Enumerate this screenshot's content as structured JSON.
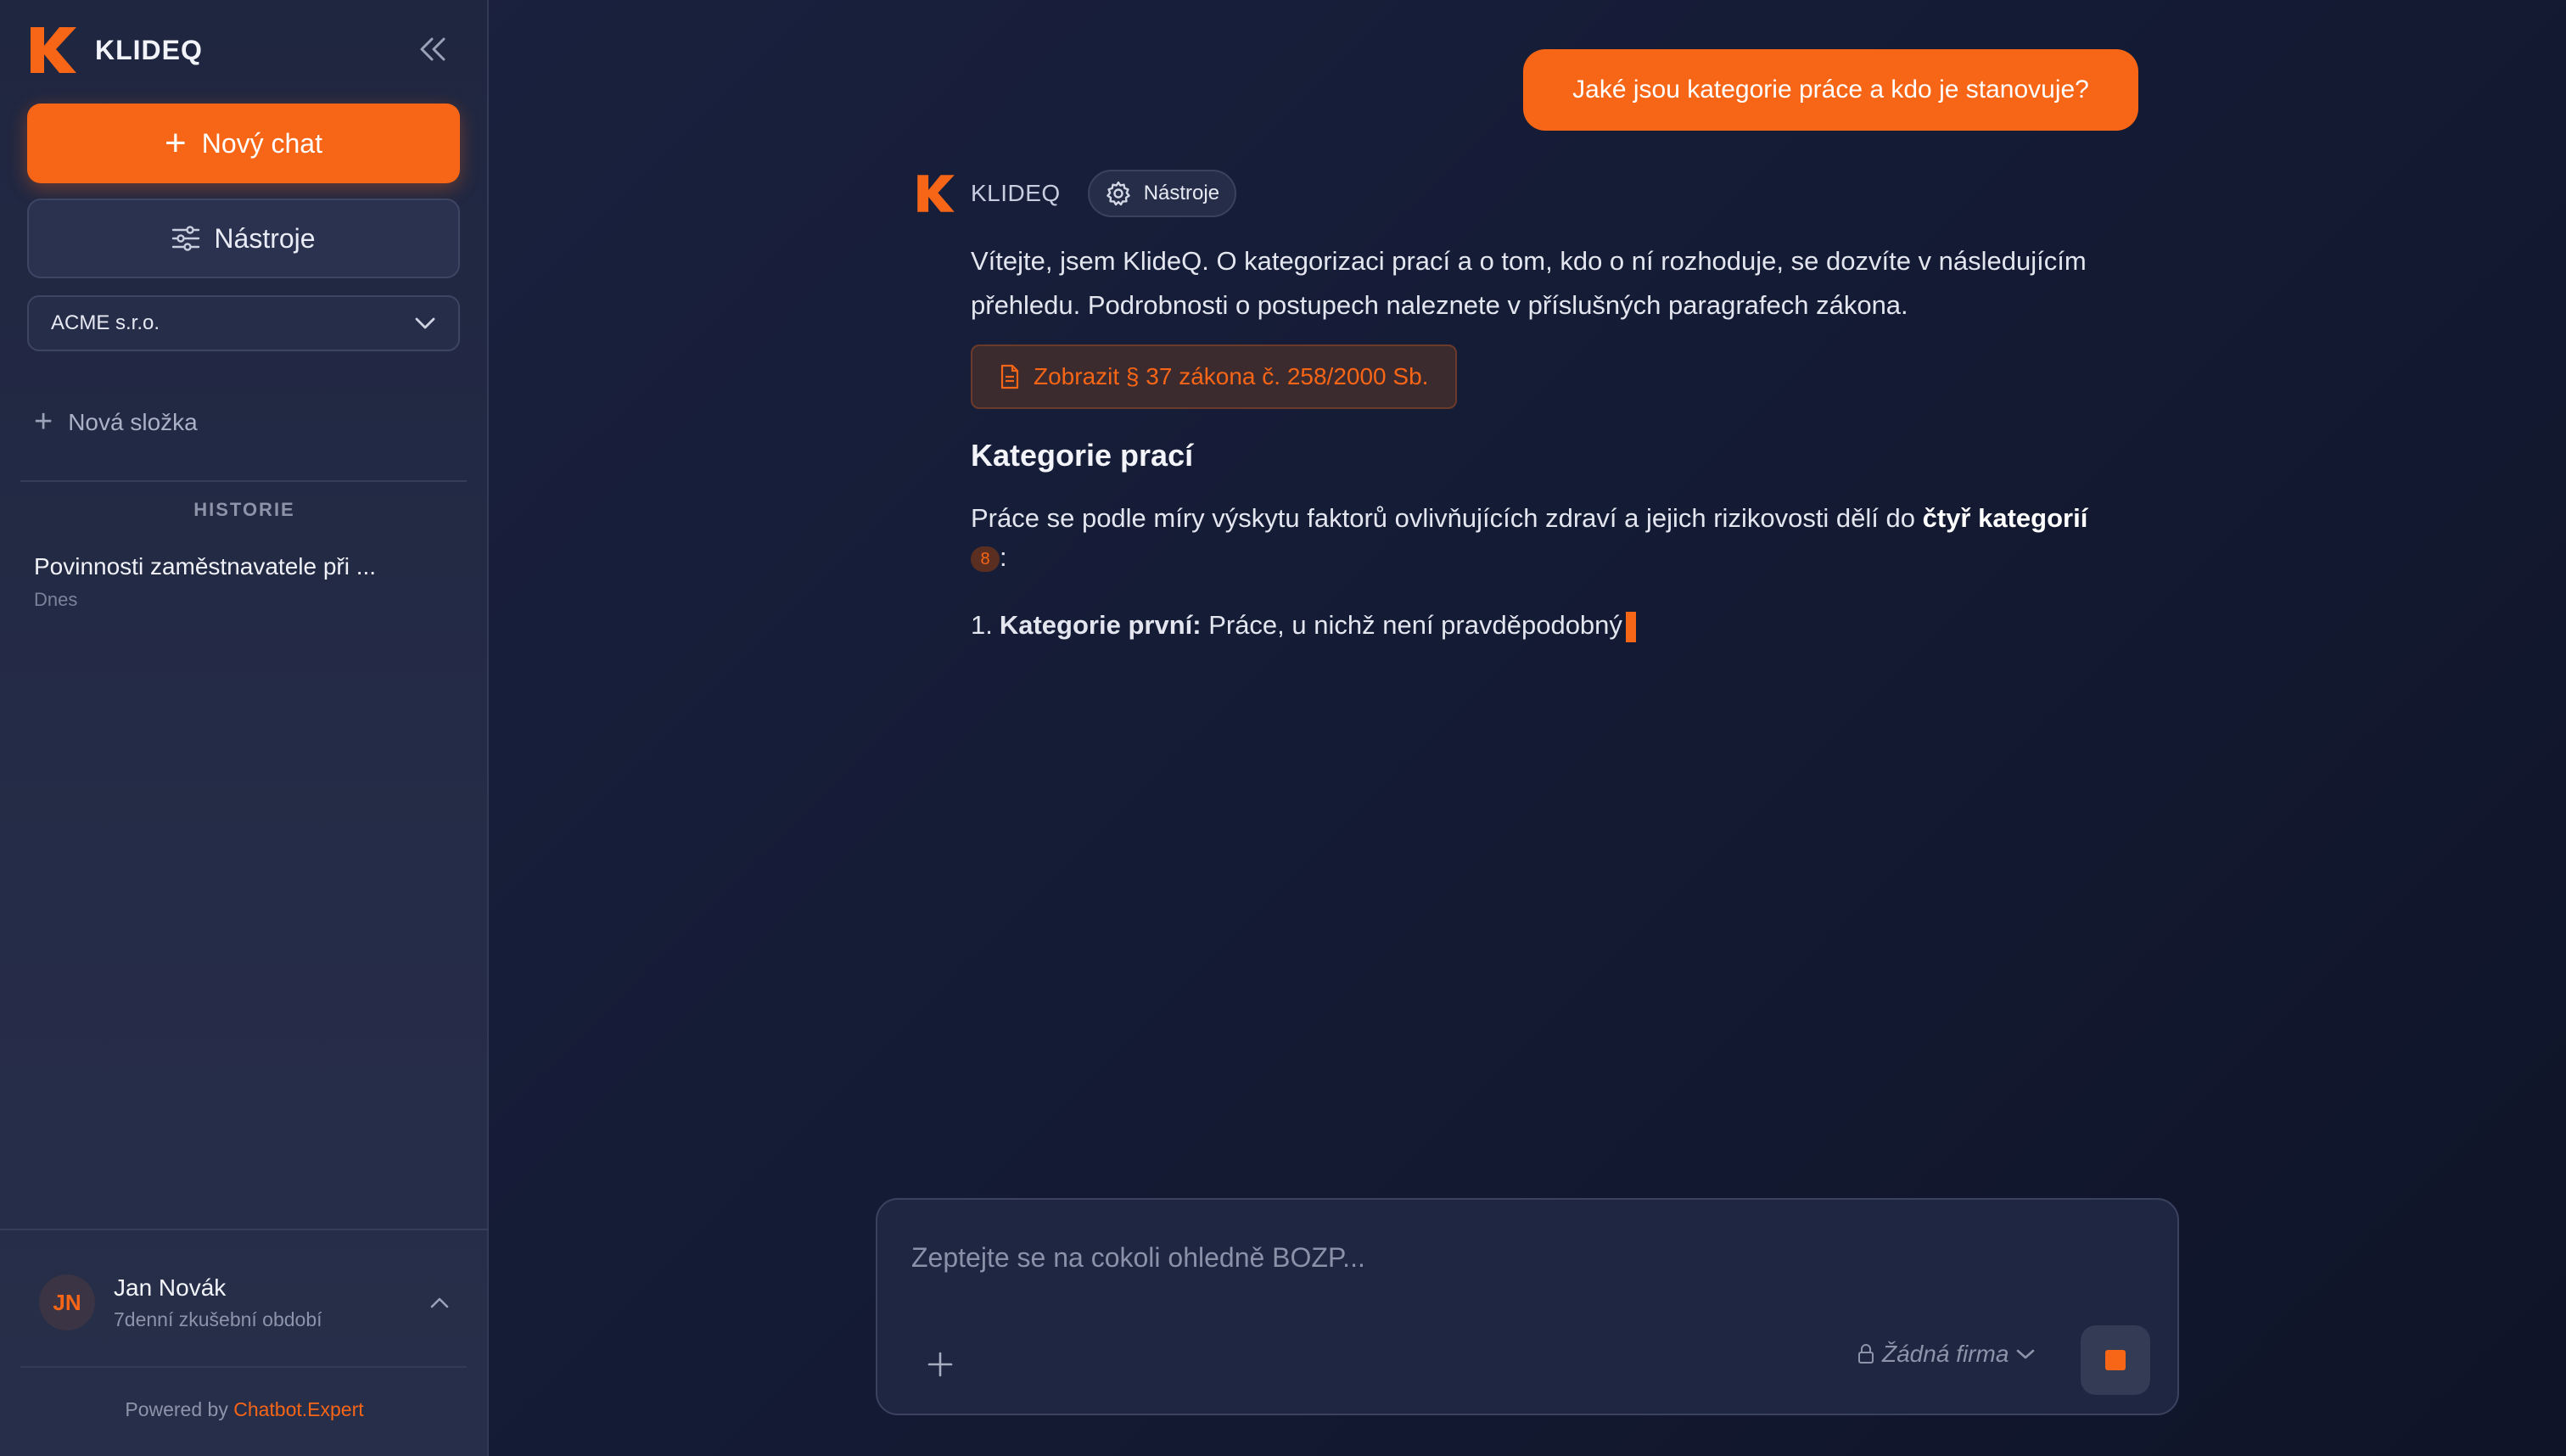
{
  "sidebar": {
    "brand": "KLIDEQ",
    "new_chat_label": "Nový chat",
    "tools_label": "Nástroje",
    "company_selected": "ACME s.r.o.",
    "new_folder_label": "Nová složka",
    "history_title": "HISTORIE",
    "history": [
      {
        "title": "Povinnosti zaměstnavatele při ...",
        "date": "Dnes"
      }
    ],
    "user": {
      "initials": "JN",
      "name": "Jan Novák",
      "subtitle": "7denní zkušební období"
    },
    "powered_prefix": "Powered by",
    "powered_link": "Chatbot.Expert"
  },
  "chat": {
    "user_message": "Jaké jsou kategorie práce a kdo je stanovuje?",
    "bot": {
      "name": "KLIDEQ",
      "tools_chip": "Nástroje",
      "intro": "Vítejte, jsem KlideQ. O kategorizaci prací a o tom, kdo o ní rozhoduje, se dozvíte v následujícím přehledu. Podrobnosti o postupech naleznete v příslušných paragrafech zákona.",
      "law_button": "Zobrazit § 37 zákona č. 258/2000 Sb.",
      "section_title": "Kategorie prací",
      "para_prefix": "Práce se podle míry výskytu faktorů ovlivňujících zdraví a jejich rizikovosti dělí do ",
      "para_bold": "čtyř kategorií",
      "citation": "8",
      "para_suffix": ":",
      "list_num": "1.",
      "list_bold": "Kategorie první:",
      "list_text": " Práce, u nichž není pravděpodobný"
    }
  },
  "composer": {
    "placeholder": "Zeptejte se na cokoli ohledně BOZP...",
    "value": "",
    "firm_label": "Žádná firma"
  },
  "colors": {
    "accent": "#f76516",
    "background": "#161d37",
    "sidebar": "#232a45"
  },
  "icons": [
    "klideq-logo-icon",
    "collapse-icon",
    "plus-icon",
    "sliders-icon",
    "chevron-down-icon",
    "gear-icon",
    "document-icon",
    "lock-icon",
    "chevron-up-icon",
    "stop-icon"
  ]
}
